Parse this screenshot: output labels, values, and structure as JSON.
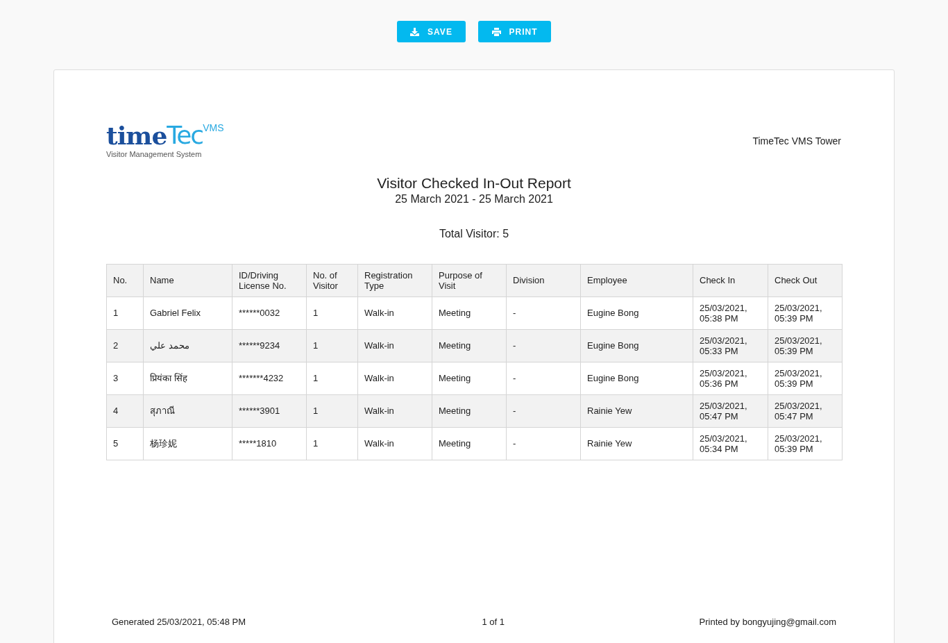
{
  "toolbar": {
    "buttons": [
      {
        "kind": "save",
        "label": "SAVE"
      },
      {
        "kind": "print",
        "label": "PRINT"
      }
    ]
  },
  "logo": {
    "wordmark_left": "time",
    "wordmark_right": "Tec",
    "suffix": "VMS",
    "tagline": "Visitor Management System"
  },
  "company": "TimeTec VMS Tower",
  "report": {
    "title": "Visitor Checked In-Out Report",
    "date_range": "25 March 2021 - 25 March 2021",
    "total": "Total Visitor: 5"
  },
  "table": {
    "columns": [
      "No.",
      "Name",
      "ID/Driving License No.",
      "No. of Visitor",
      "Registration Type",
      "Purpose of Visit",
      "Division",
      "Employee",
      "Check In",
      "Check Out"
    ],
    "rows": [
      [
        "1",
        "Gabriel Felix",
        "******0032",
        "1",
        "Walk-in",
        "Meeting",
        "-",
        "Eugine Bong",
        "25/03/2021, 05:38 PM",
        "25/03/2021, 05:39 PM"
      ],
      [
        "2",
        "محمد علي",
        "******9234",
        "1",
        "Walk-in",
        "Meeting",
        "-",
        "Eugine Bong",
        "25/03/2021, 05:33 PM",
        "25/03/2021, 05:39 PM"
      ],
      [
        "3",
        "प्रियंका सिंह",
        "*******4232",
        "1",
        "Walk-in",
        "Meeting",
        "-",
        "Eugine Bong",
        "25/03/2021, 05:36 PM",
        "25/03/2021, 05:39 PM"
      ],
      [
        "4",
        "สุภาณี",
        "******3901",
        "1",
        "Walk-in",
        "Meeting",
        "-",
        "Rainie Yew",
        "25/03/2021, 05:47 PM",
        "25/03/2021, 05:47 PM"
      ],
      [
        "5",
        "杨珍妮",
        "*****1810",
        "1",
        "Walk-in",
        "Meeting",
        "-",
        "Rainie Yew",
        "25/03/2021, 05:34 PM",
        "25/03/2021, 05:39 PM"
      ]
    ]
  },
  "footer": {
    "generated": "Generated 25/03/2021, 05:48 PM",
    "page": "1 of 1",
    "printed_by": "Printed by bongyujing@gmail.com"
  }
}
